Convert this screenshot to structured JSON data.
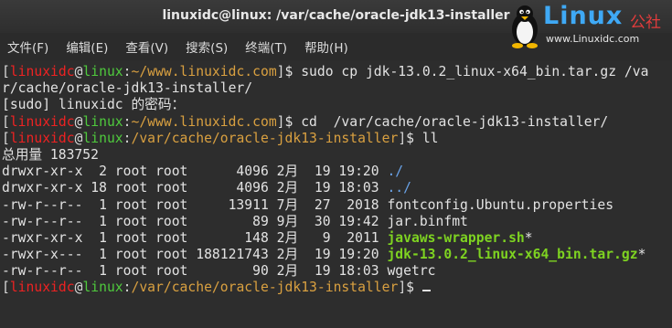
{
  "window": {
    "title": "linuxidc@linux: /var/cache/oracle-jdk13-installer"
  },
  "menu": [
    "文件(F)",
    "编辑(E)",
    "查看(V)",
    "搜索(S)",
    "终端(T)",
    "帮助(H)"
  ],
  "logo": {
    "word": "Linux",
    "cn": "公社",
    "url": "www.Linuxidc.com"
  },
  "terminal": {
    "l0": {
      "user": "linuxidc",
      "host": "linux",
      "path": "~/www.linuxidc.com",
      "cmd": "$ sudo cp jdk-13.0.2_linux-x64_bin.tar.gz /va"
    },
    "l1": "r/cache/oracle-jdk13-installer/",
    "l2": "[sudo] linuxidc 的密码：",
    "l3": {
      "user": "linuxidc",
      "host": "linux",
      "path": "~/www.linuxidc.com",
      "cmd": "$ cd  /var/cache/oracle-jdk13-installer/"
    },
    "l4": {
      "user": "linuxidc",
      "host": "linux",
      "path": "/var/cache/oracle-jdk13-installer",
      "cmd": "$ ll"
    },
    "total": "总用量 183752",
    "files": [
      {
        "meta": "drwxr-xr-x  2 root root      4096 2月  19 19:20 ",
        "name": "./",
        "kind": "dir"
      },
      {
        "meta": "drwxr-xr-x 18 root root      4096 2月  19 18:03 ",
        "name": "../",
        "kind": "dir"
      },
      {
        "meta": "-rw-r--r--  1 root root     13911 7月  27  2018 ",
        "name": "fontconfig.Ubuntu.properties",
        "kind": "file"
      },
      {
        "meta": "-rw-r--r--  1 root root        89 9月  30 19:42 ",
        "name": "jar.binfmt",
        "kind": "file"
      },
      {
        "meta": "-rwxr-xr-x  1 root root       148 2月   9  2011 ",
        "name": "javaws-wrapper.sh",
        "suffix": "*",
        "kind": "exe"
      },
      {
        "meta": "-rwxr-x---  1 root root 188121743 2月  19 19:20 ",
        "name": "jdk-13.0.2_linux-x64_bin.tar.gz",
        "suffix": "*",
        "kind": "exe"
      },
      {
        "meta": "-rw-r--r--  1 root root        90 2月  19 18:03 ",
        "name": "wgetrc",
        "kind": "file"
      }
    ],
    "l_last": {
      "user": "linuxidc",
      "host": "linux",
      "path": "/var/cache/oracle-jdk13-installer",
      "cmd": "$ "
    }
  }
}
